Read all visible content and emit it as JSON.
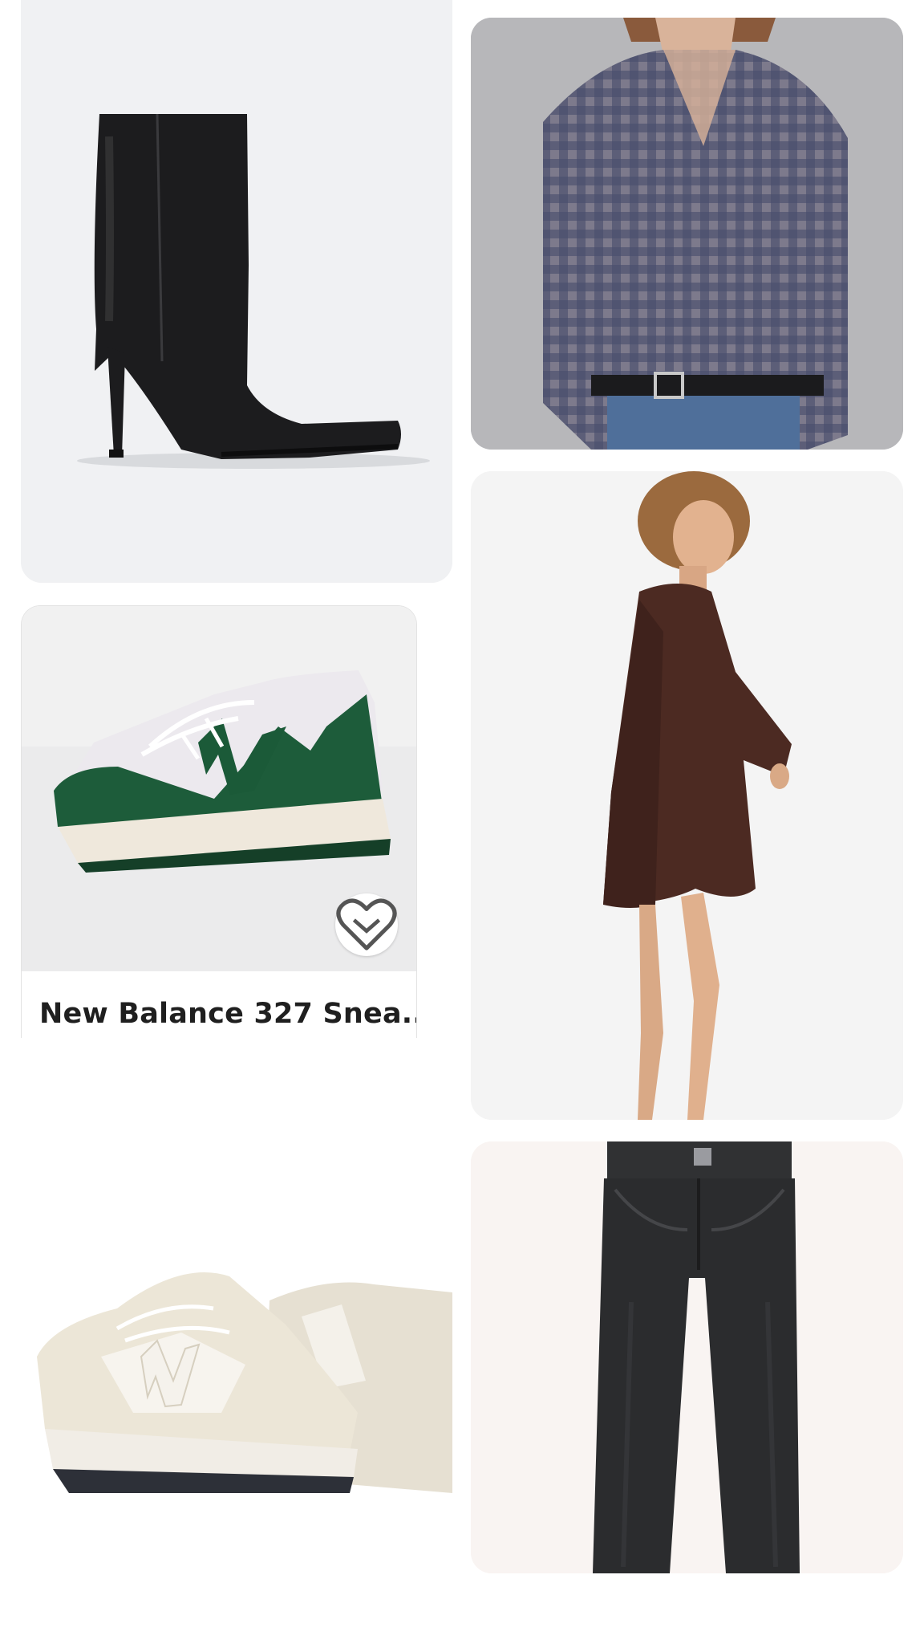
{
  "feed": {
    "items": [
      {
        "id": "boot",
        "image": "black-leather-heeled-ankle-boot"
      },
      {
        "id": "plaid-shirt",
        "image": "navy-gingham-sheer-shirt"
      },
      {
        "id": "nb327",
        "image": "green-white-sneaker",
        "title": "New Balance 327 Snea...",
        "save_icon": "heart-icon"
      },
      {
        "id": "brown-shirt",
        "image": "brown-oversized-shirt-dress"
      },
      {
        "id": "nb2002",
        "image": "cream-new-balance-sneakers"
      },
      {
        "id": "jeans",
        "image": "black-wide-leg-jeans"
      }
    ]
  }
}
